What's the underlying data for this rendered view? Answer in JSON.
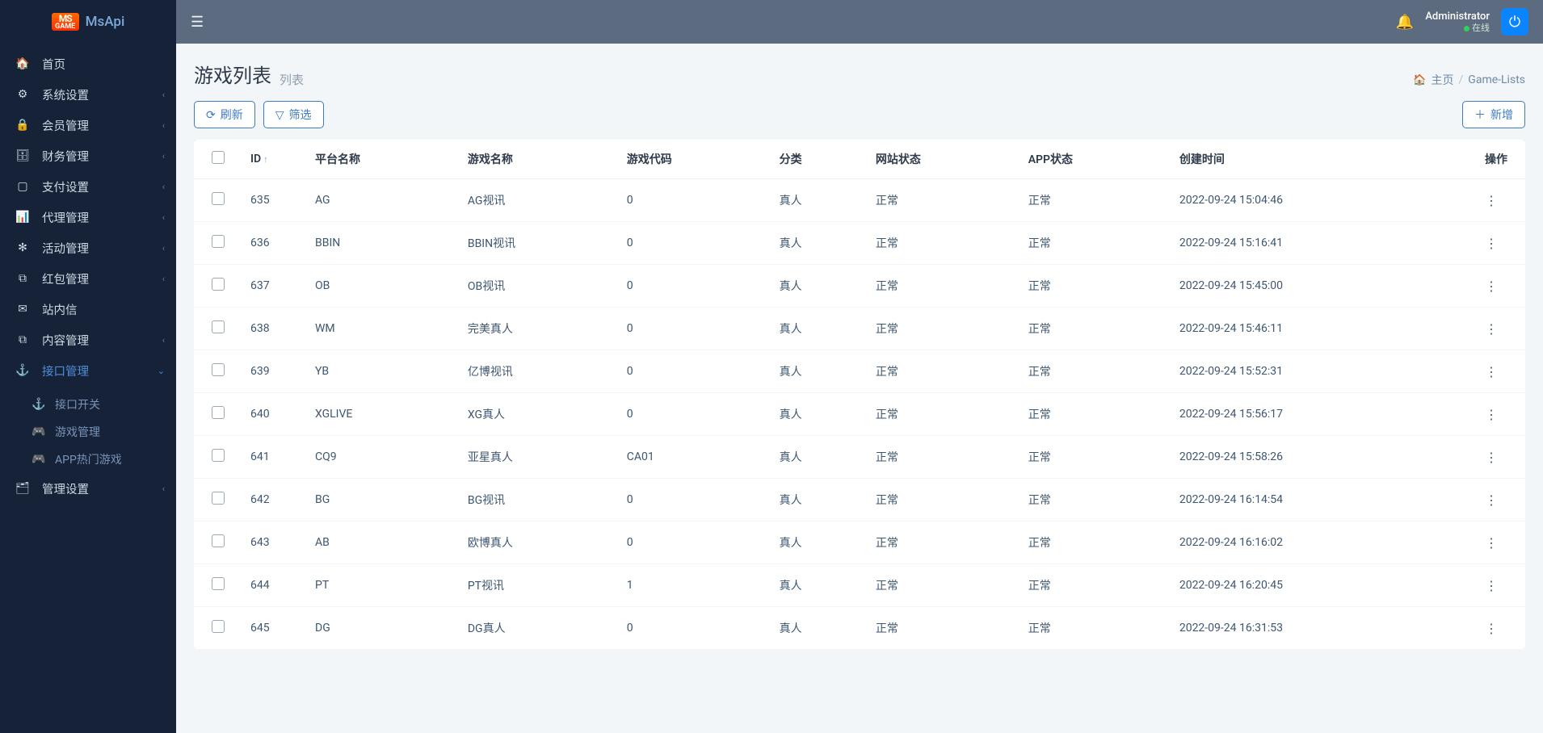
{
  "brand": {
    "logo_top": "MS",
    "logo_bottom": "GAME",
    "text": "MsApi"
  },
  "sidebar": {
    "items": [
      {
        "icon": "🏠",
        "label": "首页",
        "expand": false
      },
      {
        "icon": "⚙",
        "label": "系统设置",
        "expand": true
      },
      {
        "icon": "🔒",
        "label": "会员管理",
        "expand": true
      },
      {
        "icon": "🗄",
        "label": "财务管理",
        "expand": true
      },
      {
        "icon": "▢",
        "label": "支付设置",
        "expand": true
      },
      {
        "icon": "📊",
        "label": "代理管理",
        "expand": true
      },
      {
        "icon": "✻",
        "label": "活动管理",
        "expand": true
      },
      {
        "icon": "⧉",
        "label": "红包管理",
        "expand": true
      },
      {
        "icon": "✉",
        "label": "站内信",
        "expand": false
      },
      {
        "icon": "⧉",
        "label": "内容管理",
        "expand": true
      },
      {
        "icon": "⚓",
        "label": "接口管理",
        "expand": true,
        "active": true,
        "open": true,
        "children": [
          {
            "icon": "⚓",
            "label": "接口开关"
          },
          {
            "icon": "🎮",
            "label": "游戏管理"
          },
          {
            "icon": "🎮",
            "label": "APP热门游戏"
          }
        ]
      },
      {
        "icon": "🗂",
        "label": "管理设置",
        "expand": true
      }
    ]
  },
  "topbar": {
    "user_name": "Administrator",
    "user_status": "在线"
  },
  "page": {
    "title": "游戏列表",
    "subtitle": "列表",
    "breadcrumb_home": "主页",
    "breadcrumb_current": "Game-Lists"
  },
  "toolbar": {
    "refresh": "刷新",
    "filter": "筛选",
    "add": "新增"
  },
  "table": {
    "headers": {
      "id": "ID",
      "platform": "平台名称",
      "game": "游戏名称",
      "code": "游戏代码",
      "category": "分类",
      "web_status": "网站状态",
      "app_status": "APP状态",
      "created": "创建时间",
      "action": "操作"
    },
    "rows": [
      {
        "id": "635",
        "platform": "AG",
        "game": "AG视讯",
        "code": "0",
        "category": "真人",
        "web_status": "正常",
        "app_status": "正常",
        "created": "2022-09-24 15:04:46"
      },
      {
        "id": "636",
        "platform": "BBIN",
        "game": "BBIN视讯",
        "code": "0",
        "category": "真人",
        "web_status": "正常",
        "app_status": "正常",
        "created": "2022-09-24 15:16:41"
      },
      {
        "id": "637",
        "platform": "OB",
        "game": "OB视讯",
        "code": "0",
        "category": "真人",
        "web_status": "正常",
        "app_status": "正常",
        "created": "2022-09-24 15:45:00"
      },
      {
        "id": "638",
        "platform": "WM",
        "game": "完美真人",
        "code": "0",
        "category": "真人",
        "web_status": "正常",
        "app_status": "正常",
        "created": "2022-09-24 15:46:11"
      },
      {
        "id": "639",
        "platform": "YB",
        "game": "亿博视讯",
        "code": "0",
        "category": "真人",
        "web_status": "正常",
        "app_status": "正常",
        "created": "2022-09-24 15:52:31"
      },
      {
        "id": "640",
        "platform": "XGLIVE",
        "game": "XG真人",
        "code": "0",
        "category": "真人",
        "web_status": "正常",
        "app_status": "正常",
        "created": "2022-09-24 15:56:17"
      },
      {
        "id": "641",
        "platform": "CQ9",
        "game": "亚星真人",
        "code": "CA01",
        "category": "真人",
        "web_status": "正常",
        "app_status": "正常",
        "created": "2022-09-24 15:58:26"
      },
      {
        "id": "642",
        "platform": "BG",
        "game": "BG视讯",
        "code": "0",
        "category": "真人",
        "web_status": "正常",
        "app_status": "正常",
        "created": "2022-09-24 16:14:54"
      },
      {
        "id": "643",
        "platform": "AB",
        "game": "欧博真人",
        "code": "0",
        "category": "真人",
        "web_status": "正常",
        "app_status": "正常",
        "created": "2022-09-24 16:16:02"
      },
      {
        "id": "644",
        "platform": "PT",
        "game": "PT视讯",
        "code": "1",
        "category": "真人",
        "web_status": "正常",
        "app_status": "正常",
        "created": "2022-09-24 16:20:45"
      },
      {
        "id": "645",
        "platform": "DG",
        "game": "DG真人",
        "code": "0",
        "category": "真人",
        "web_status": "正常",
        "app_status": "正常",
        "created": "2022-09-24 16:31:53"
      }
    ]
  }
}
